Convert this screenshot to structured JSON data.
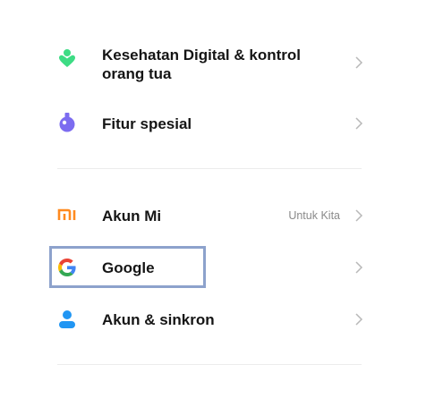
{
  "items": [
    {
      "label": "Kesehatan Digital & kontrol orang tua",
      "icon": "digital-wellbeing-icon",
      "icon_color": "#3ddc84"
    },
    {
      "label": "Fitur spesial",
      "icon": "special-features-icon",
      "icon_color": "#7c6cf0"
    },
    {
      "label": "Akun Mi",
      "value": "Untuk Kita",
      "icon": "mi-account-icon",
      "icon_color": "#ff8a1f"
    },
    {
      "label": "Google",
      "icon": "google-icon"
    },
    {
      "label": "Akun & sinkron",
      "icon": "account-sync-icon",
      "icon_color": "#2196f3"
    }
  ],
  "colors": {
    "focus_outline": "#8da2cc",
    "chevron": "#b8b8b8",
    "divider": "#ececec"
  }
}
